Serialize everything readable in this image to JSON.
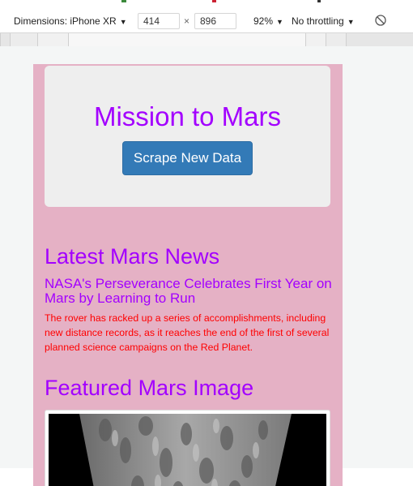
{
  "devtools": {
    "dimensions_label": "Dimensions: iPhone XR",
    "width_value": "414",
    "times": "×",
    "height_value": "896",
    "zoom": "92%",
    "throttling": "No throttling",
    "dropdown_caret": "▼"
  },
  "page": {
    "jumbotron_title": "Mission to Mars",
    "scrape_button": "Scrape New Data",
    "news_heading": "Latest Mars News",
    "news_title": "NASA's Perseverance Celebrates First Year on Mars by Learning to Run",
    "news_paragraph": "The rover has racked up a series of accomplishments, including new distance records, as it reaches the end of the first of several planned science campaigns on the Red Planet.",
    "featured_heading": "Featured Mars Image"
  },
  "colors": {
    "page_bg": "#e5b1c5",
    "jumbotron_bg": "#eeeeee",
    "heading_purple": "#a300ff",
    "paragraph_red": "#ff0000",
    "button_blue": "#337ab7"
  },
  "icons": {
    "rotate": "rotate-icon"
  }
}
